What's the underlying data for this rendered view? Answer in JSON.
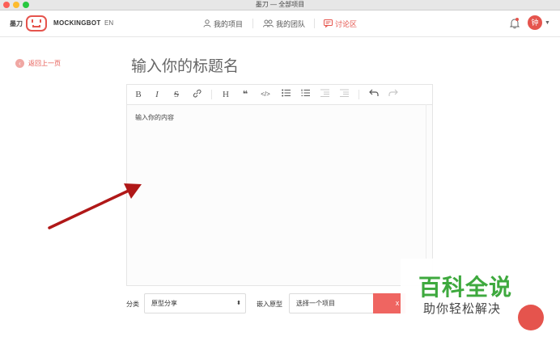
{
  "window": {
    "title": "墨刀 — 全部项目"
  },
  "header": {
    "brand_cn": "墨刀",
    "brand": "MOCKINGBOT",
    "lang": "EN",
    "nav": [
      {
        "label": "我的项目",
        "icon": "user-icon"
      },
      {
        "label": "我的团队",
        "icon": "team-icon"
      },
      {
        "label": "讨论区",
        "icon": "discussion-icon",
        "active": true
      }
    ],
    "avatar_initial": "钟"
  },
  "back": {
    "label": "返回上一页"
  },
  "post": {
    "title_placeholder": "输入你的标题名",
    "content_placeholder": "输入你的内容"
  },
  "toolbar": {
    "bold": "B",
    "italic": "I",
    "strike": "S",
    "heading": "H"
  },
  "form": {
    "category_label": "分类",
    "category_value": "原型分享",
    "embed_label": "嵌入原型",
    "embed_placeholder": "选择一个项目",
    "submit_label": "x"
  },
  "watermark": {
    "main": "百科全说",
    "sub": "助你轻松解决"
  },
  "colors": {
    "accent": "#e5544d",
    "button": "#ef6561",
    "watermark": "#3ea93e",
    "arrow": "#b01818"
  }
}
